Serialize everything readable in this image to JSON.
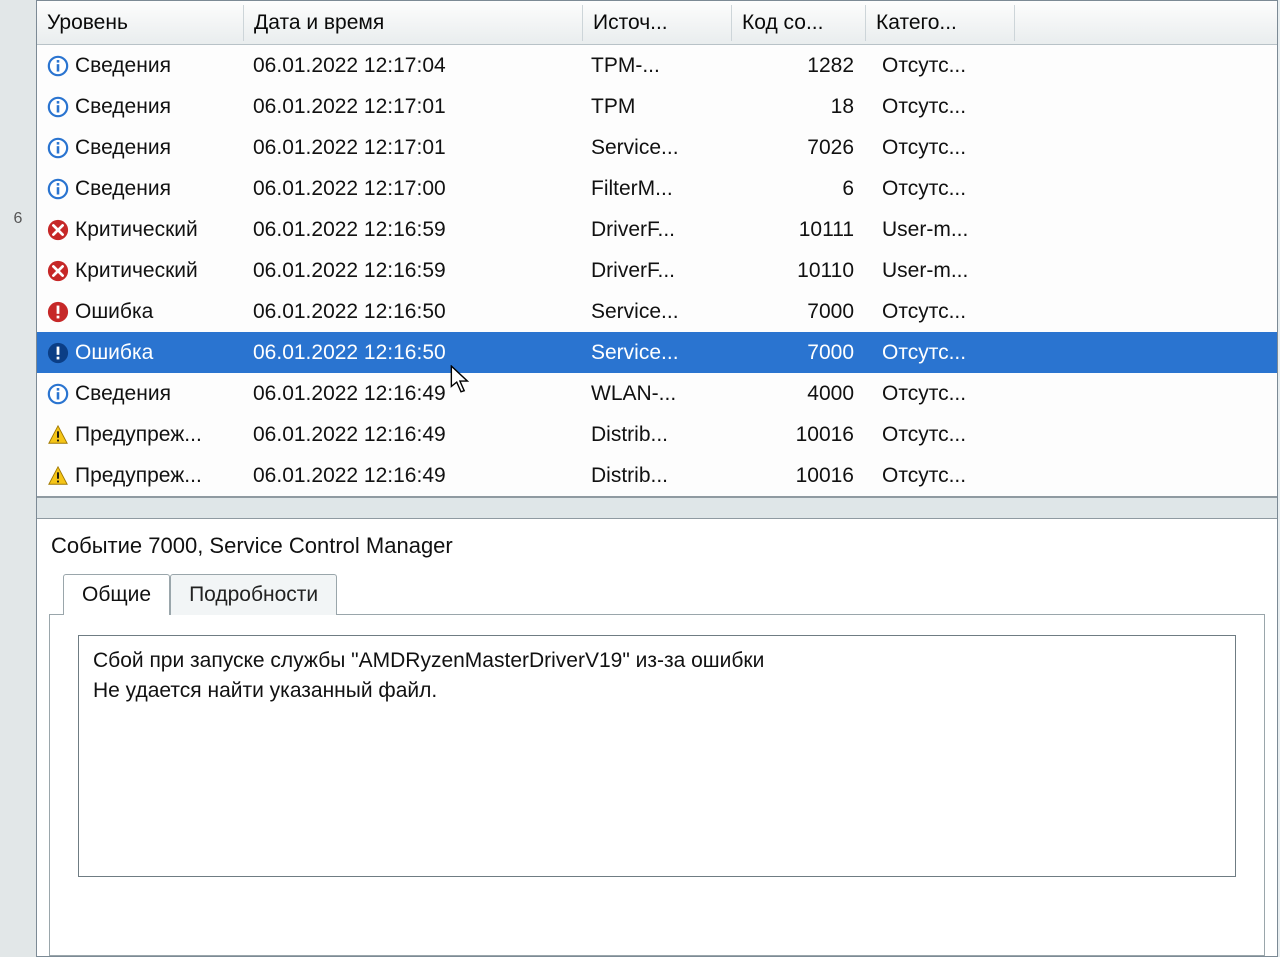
{
  "columns": {
    "level": "Уровень",
    "date": "Дата и время",
    "source": "Источ...",
    "id": "Код со...",
    "category": "Катего..."
  },
  "rows": [
    {
      "icon": "info",
      "level": "Сведения",
      "date": "06.01.2022 12:17:04",
      "source": "TPM-...",
      "id": "1282",
      "cat": "Отсутс..."
    },
    {
      "icon": "info",
      "level": "Сведения",
      "date": "06.01.2022 12:17:01",
      "source": "TPM",
      "id": "18",
      "cat": "Отсутс..."
    },
    {
      "icon": "info",
      "level": "Сведения",
      "date": "06.01.2022 12:17:01",
      "source": "Service...",
      "id": "7026",
      "cat": "Отсутс..."
    },
    {
      "icon": "info",
      "level": "Сведения",
      "date": "06.01.2022 12:17:00",
      "source": "FilterM...",
      "id": "6",
      "cat": "Отсутс..."
    },
    {
      "icon": "critical",
      "level": "Критический",
      "date": "06.01.2022 12:16:59",
      "source": "DriverF...",
      "id": "10111",
      "cat": "User-m..."
    },
    {
      "icon": "critical",
      "level": "Критический",
      "date": "06.01.2022 12:16:59",
      "source": "DriverF...",
      "id": "10110",
      "cat": "User-m..."
    },
    {
      "icon": "error",
      "level": "Ошибка",
      "date": "06.01.2022 12:16:50",
      "source": "Service...",
      "id": "7000",
      "cat": "Отсутс..."
    },
    {
      "icon": "error",
      "level": "Ошибка",
      "date": "06.01.2022 12:16:50",
      "source": "Service...",
      "id": "7000",
      "cat": "Отсутс...",
      "selected": true
    },
    {
      "icon": "info",
      "level": "Сведения",
      "date": "06.01.2022 12:16:49",
      "source": "WLAN-...",
      "id": "4000",
      "cat": "Отсутс..."
    },
    {
      "icon": "warn",
      "level": "Предупреж...",
      "date": "06.01.2022 12:16:49",
      "source": "Distrib...",
      "id": "10016",
      "cat": "Отсутс..."
    },
    {
      "icon": "warn",
      "level": "Предупреж...",
      "date": "06.01.2022 12:16:49",
      "source": "Distrib...",
      "id": "10016",
      "cat": "Отсутс..."
    }
  ],
  "detail": {
    "title": "Событие 7000, Service Control Manager",
    "tabs": {
      "general": "Общие",
      "details": "Подробности"
    },
    "message_line1": "Сбой при запуске службы \"AMDRyzenMasterDriverV19\" из-за ошибки",
    "message_line2": "Не удается найти указанный файл."
  },
  "leftrail": "6"
}
